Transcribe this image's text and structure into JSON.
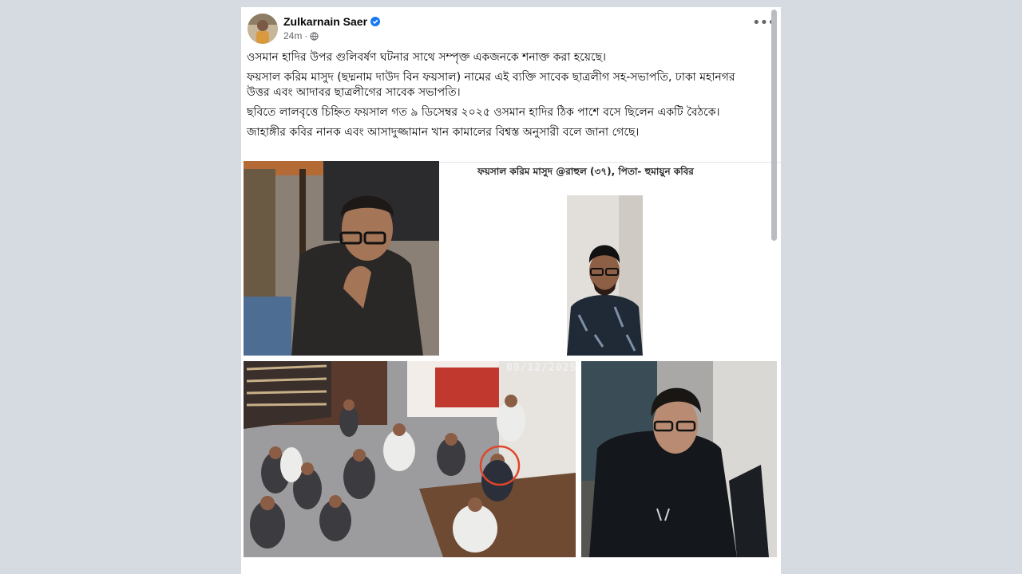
{
  "post": {
    "author": "Zulkarnain Saer",
    "time": "24m",
    "paragraphs": [
      "ওসমান হাদির উপর গুলিবর্ষণ ঘটনার সাথে সম্পৃক্ত একজনকে শনাক্ত করা হয়েছে।",
      "ফয়সাল করিম মাসুদ (ছদ্মনাম দাউদ বিন ফয়সাল) নামের এই ব্যক্তি সাবেক ছাত্রলীগ সহ-সভাপতি, ঢাকা মহানগর উত্তর এবং আদাবর ছাত্রলীগের সাবেক সভাপতি।",
      "ছবিতে লালবৃত্তে চিহ্নিত ফয়সাল গত ৯ ডিসেম্বর ২০২৫ ওসমান হাদির ঠিক পাশে বসে ছিলেন একটি বৈঠকে।",
      "জাহাঙ্গীর কবির নানক এবং আসাদুজ্জামান খান কামালের বিশ্বস্ত অনুসারী বলে জানা গেছে।"
    ]
  },
  "images": {
    "caption": "ফয়সাল করিম মাসুদ @রাহুল (৩৭), পিতা- হুমায়ুন কবির",
    "cctv_timestamp": "09/12/2025"
  },
  "colors": {
    "verified": "#1877f2",
    "highlight_circle": "#e0452b",
    "page_bg": "#d5dbe1"
  }
}
